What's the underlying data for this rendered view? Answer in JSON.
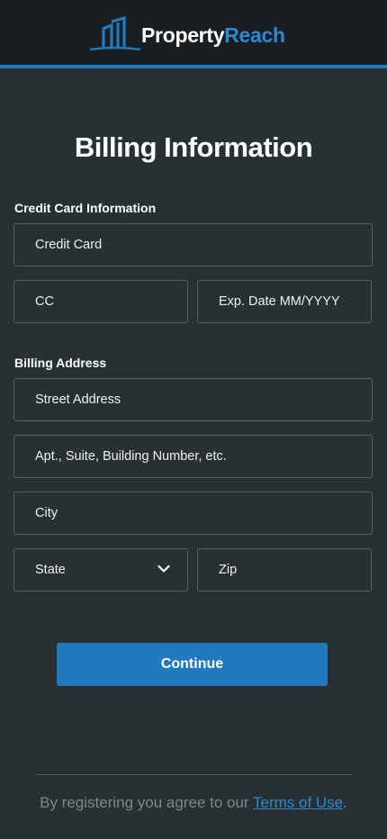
{
  "brand": {
    "name_part1": "Property",
    "name_part2": "Reach",
    "logo_icon": "buildings-icon",
    "accent_color": "#2179be"
  },
  "page": {
    "title": "Billing Information"
  },
  "credit_card_section": {
    "label": "Credit Card Information",
    "card_number_placeholder": "Credit Card",
    "cvc_placeholder": "CC",
    "expiry_placeholder": "Exp. Date MM/YYYY"
  },
  "billing_address_section": {
    "label": "Billing Address",
    "street_placeholder": "Street Address",
    "apt_placeholder": "Apt., Suite, Building Number, etc.",
    "city_placeholder": "City",
    "state_placeholder": "State",
    "zip_placeholder": "Zip"
  },
  "actions": {
    "continue_label": "Continue"
  },
  "footer": {
    "text": "By registering you agree to our ",
    "link_label": "Terms of Use",
    "suffix": "."
  }
}
